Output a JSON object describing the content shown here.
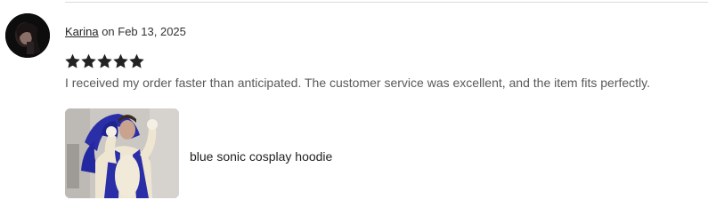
{
  "review": {
    "author": "Karina",
    "date_prefix": " on ",
    "date": "Feb 13, 2025",
    "rating": 5,
    "rating_max": 5,
    "text": "I received my order faster than anticipated. The customer service was excellent, and the item fits perfectly.",
    "item": {
      "title": "blue sonic cosplay hoodie"
    }
  },
  "colors": {
    "star": "#222222",
    "divider": "#dcdcdc",
    "body_text": "#595959"
  },
  "icons": {
    "star": "star-icon"
  }
}
